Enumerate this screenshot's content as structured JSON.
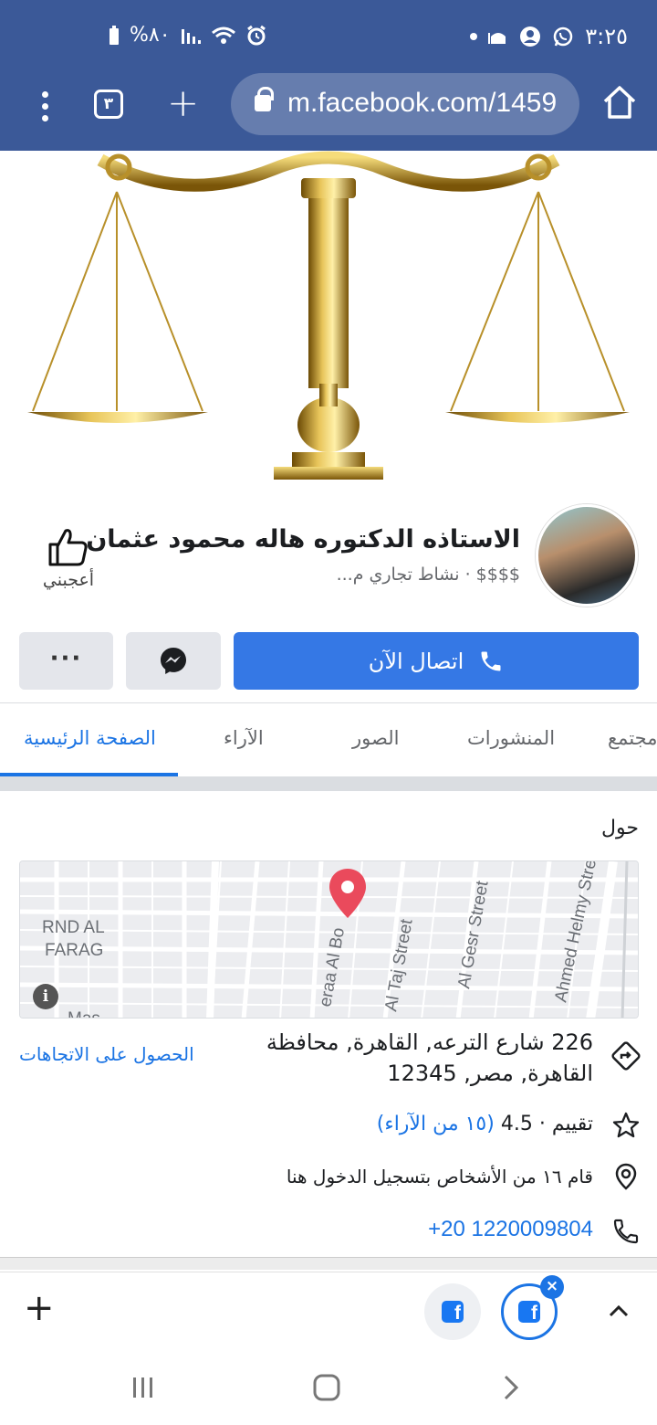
{
  "status_bar": {
    "time": "٣:٢٥",
    "battery": "%٨٠"
  },
  "browser": {
    "tab_count": "٣",
    "url": "m.facebook.com/1459"
  },
  "page": {
    "name": "الاستاذه  الدكتوره هاله محمود عثمان",
    "subtitle": "$$$$ · نشاط تجاري م...",
    "like_label": "أعجبني",
    "call_button_label": "اتصال الآن",
    "more_label": "···"
  },
  "tabs": [
    {
      "label": "الصفحة الرئيسية",
      "active": true
    },
    {
      "label": "الآراء",
      "active": false
    },
    {
      "label": "الصور",
      "active": false
    },
    {
      "label": "المنشورات",
      "active": false
    },
    {
      "label": "مجتمع",
      "active": false
    }
  ],
  "about": {
    "title": "حول",
    "map": {
      "labels": [
        "RND AL",
        "FARAG",
        "eraa Al Bo",
        "Al Taj Street",
        "Al Gesr Street",
        "Ahmed Helmy Stre",
        "Mas"
      ]
    },
    "address": "226 شارع الترعه, القاهرة, محافظة القاهرة, مصر, 12345",
    "directions_label": "الحصول على الاتجاهات",
    "rating_prefix": "تقييم · 4.5",
    "rating_reviews": "(١٥ من الآراء)",
    "checkins": "قام ١٦ من الأشخاص بتسجيل الدخول هنا",
    "phone": "+20 1220009804"
  },
  "bottom_bar": {
    "new_tab": "+",
    "tab_icon_letter": "f",
    "close": "×"
  },
  "colors": {
    "chrome": "#3b5998",
    "accent": "#1b74e4",
    "call_button": "#3578e5"
  }
}
